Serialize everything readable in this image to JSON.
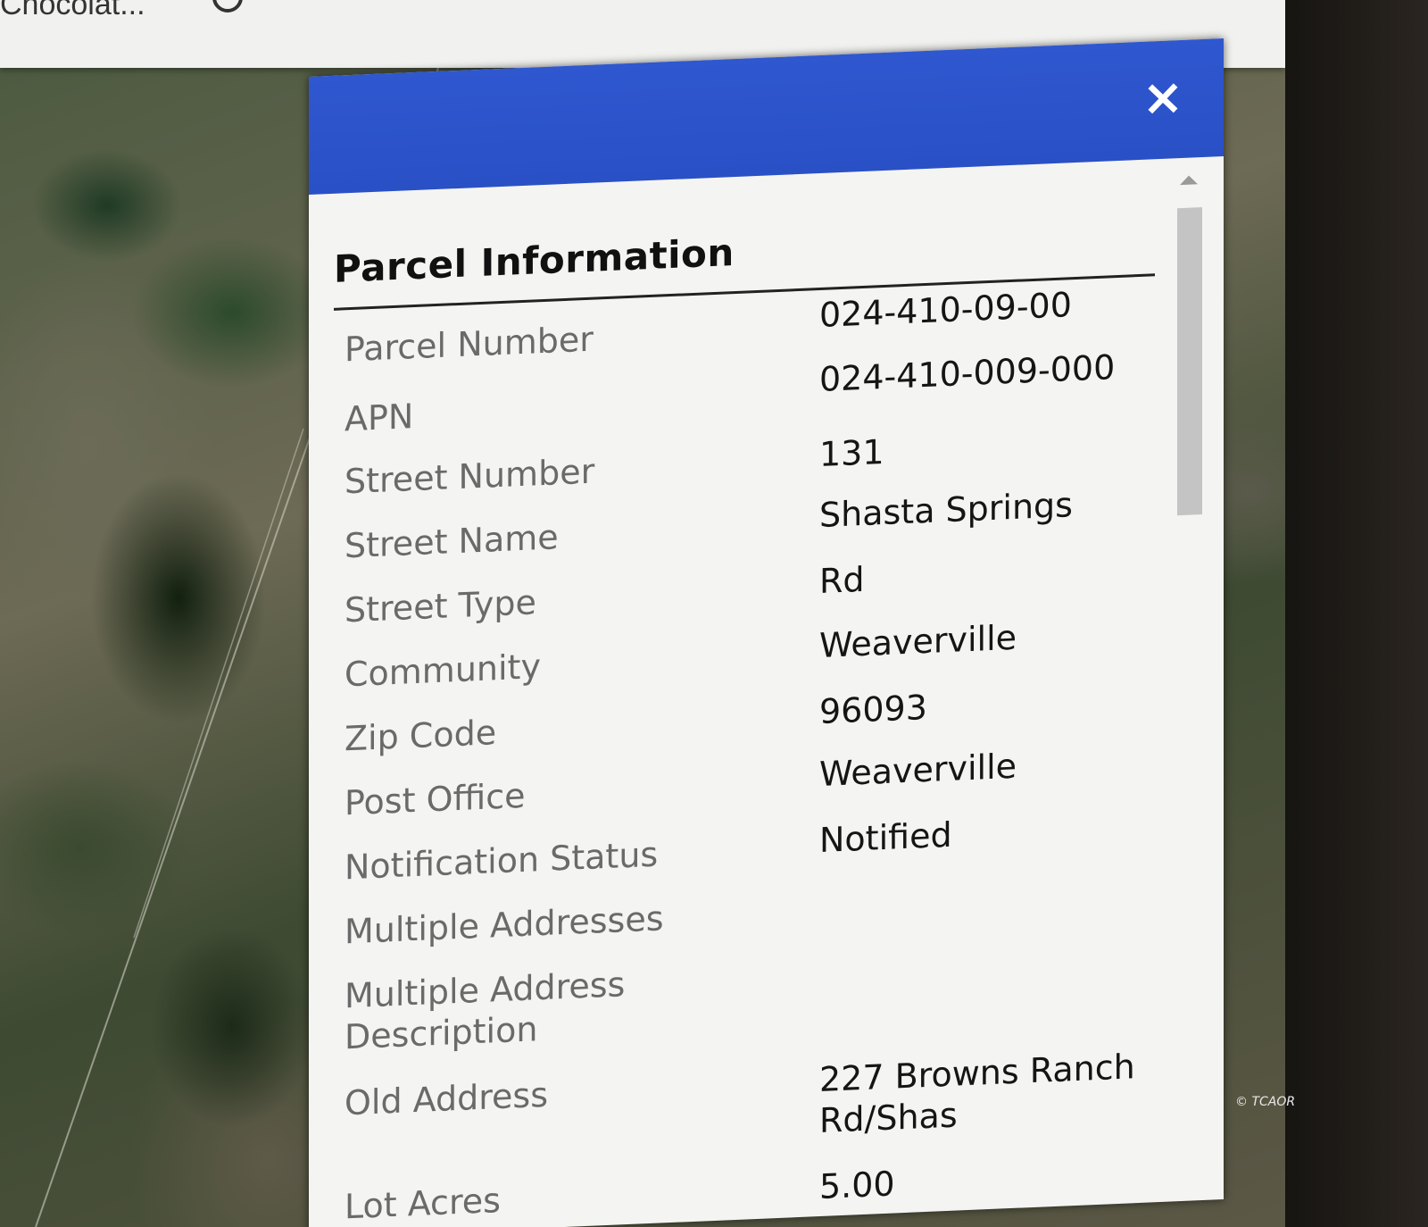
{
  "browser": {
    "tab_label": "Chocolat..."
  },
  "popup": {
    "title": "Parcel Information",
    "close_icon": "×",
    "fields": [
      {
        "label": "Parcel Number",
        "value": "024-410-09-00"
      },
      {
        "label": "APN",
        "value": "024-410-009-000"
      },
      {
        "label": "Street Number",
        "value": "131"
      },
      {
        "label": "Street Name",
        "value": "Shasta Springs"
      },
      {
        "label": "Street Type",
        "value": "Rd"
      },
      {
        "label": "Community",
        "value": "Weaverville"
      },
      {
        "label": "Zip Code",
        "value": "96093"
      },
      {
        "label": "Post Office",
        "value": "Weaverville"
      },
      {
        "label": "Notification Status",
        "value": "Notified"
      },
      {
        "label": "Multiple Addresses",
        "value": ""
      },
      {
        "label": "Multiple Address Description",
        "value": ""
      },
      {
        "label": "Old Address",
        "value": "227 Browns Ranch Rd/Shas"
      },
      {
        "label": "Lot Acres",
        "value": "5.00"
      }
    ]
  },
  "colors": {
    "header_blue": "#2c53ca",
    "label_gray": "#6a6a6a",
    "value_black": "#151515"
  },
  "watermark": "© TCAOR"
}
